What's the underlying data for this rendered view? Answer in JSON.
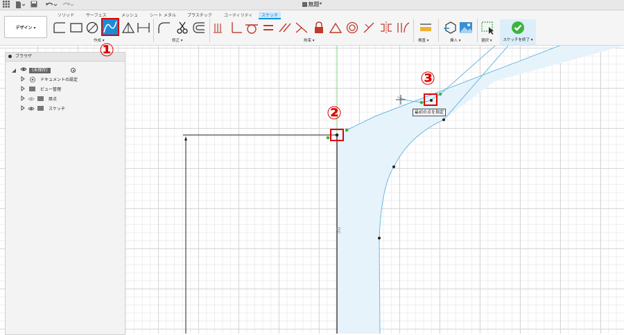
{
  "window": {
    "title": "無題*"
  },
  "tabs": [
    {
      "label": "ソリッド"
    },
    {
      "label": "サーフェス"
    },
    {
      "label": "メッシュ"
    },
    {
      "label": "シート メタル"
    },
    {
      "label": "プラスチック"
    },
    {
      "label": "ユーティリティ"
    },
    {
      "label": "スケッチ"
    }
  ],
  "active_tab": "スケッチ",
  "workspace": {
    "label": "デザイン ▾"
  },
  "groups": {
    "create": "作成 ▾",
    "modify": "修正 ▾",
    "constraints": "拘束 ▾",
    "inspect": "検査 ▾",
    "insert": "挿入 ▾",
    "select": "選択 ▾",
    "finish": "スケッチを終了 ▾"
  },
  "browser": {
    "title": "ブラウザ",
    "items": [
      {
        "label": "(未保存)"
      },
      {
        "label": "ドキュメントの設定"
      },
      {
        "label": "ビュー管理"
      },
      {
        "label": "原点"
      },
      {
        "label": "スケッチ"
      }
    ]
  },
  "canvas": {
    "dimension_label": "50",
    "tooltip": "最初の点を指定"
  },
  "callouts": {
    "one": "①",
    "two": "②",
    "three": "③"
  },
  "colors": {
    "accent": "#0696d7",
    "annotation": "#e00000",
    "sketch_fill": "#e6f3fb",
    "sketch_line": "#6bb8e0",
    "check": "#3cb43c"
  }
}
